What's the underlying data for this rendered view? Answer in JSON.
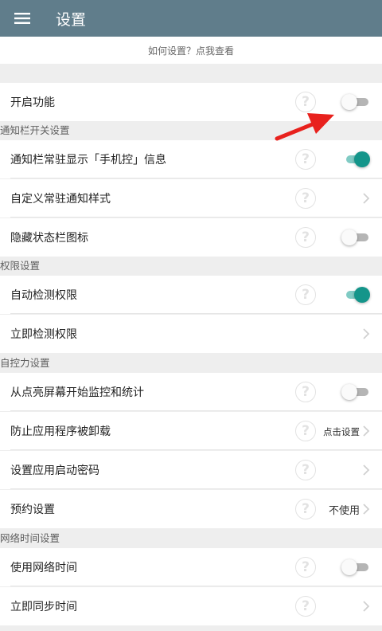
{
  "header": {
    "title": "设置",
    "menu_icon": "hamburger-menu-icon"
  },
  "help_link": "如何设置？点我查看",
  "rows": {
    "enable_feature": {
      "label": "开启功能",
      "toggle": "off"
    },
    "notif_show": {
      "label": "通知栏常驻显示「手机控」信息",
      "toggle": "on"
    },
    "notif_style": {
      "label": "自定义常驻通知样式"
    },
    "hide_status_icon": {
      "label": "隐藏状态栏图标",
      "toggle": "off"
    },
    "auto_check_perm": {
      "label": "自动检测权限",
      "toggle": "on"
    },
    "check_perm_now": {
      "label": "立即检测权限"
    },
    "monitor_screen_on": {
      "label": "从点亮屏幕开始监控和统计",
      "toggle": "off"
    },
    "prevent_uninstall": {
      "label": "防止应用程序被卸载",
      "value": "点击设置"
    },
    "app_password": {
      "label": "设置应用启动密码"
    },
    "schedule": {
      "label": "预约设置",
      "value": "不使用"
    },
    "use_network_time": {
      "label": "使用网络时间",
      "toggle": "off"
    },
    "sync_time_now": {
      "label": "立即同步时间"
    }
  },
  "sections": {
    "notification": "通知栏开关设置",
    "permission": "权限设置",
    "self_control": "自控力设置",
    "network_time": "网络时间设置"
  },
  "help_icon_char": "?",
  "colors": {
    "appbar": "#607d8b",
    "toggle_on": "#14958a",
    "arrow": "#e8211d"
  }
}
